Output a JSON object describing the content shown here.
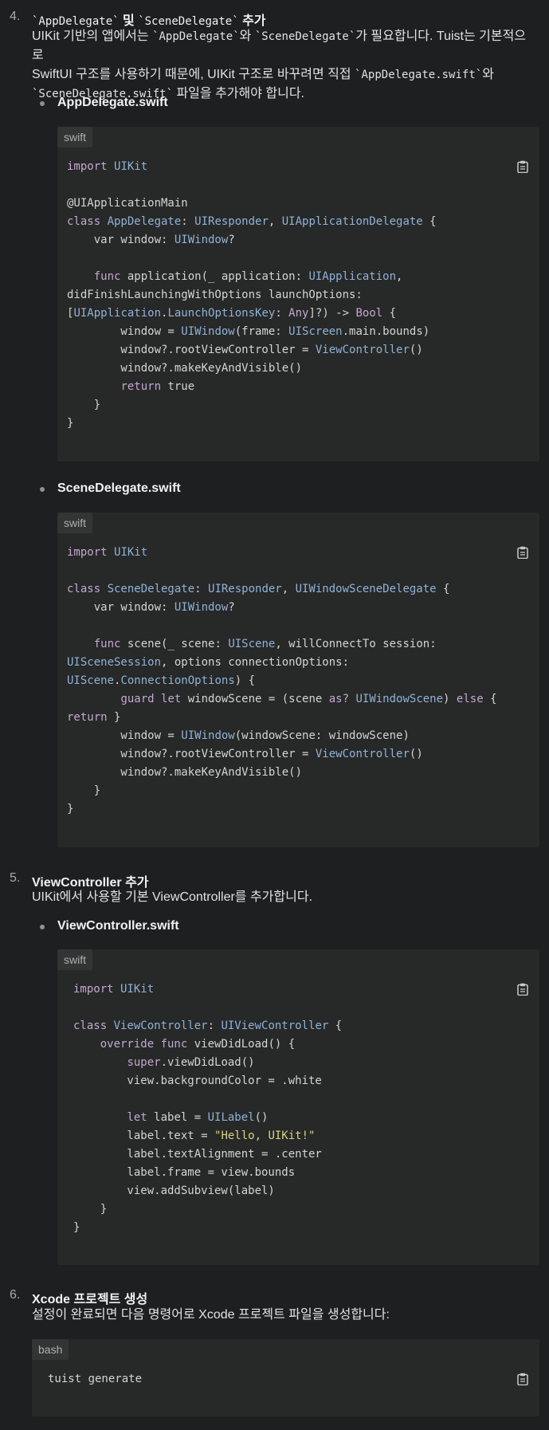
{
  "sections": {
    "s4": {
      "number": "4.",
      "title_parts": [
        "`AppDelegate`",
        " 및 ",
        "`SceneDelegate`",
        " 추가"
      ],
      "desc_line1_parts": [
        "UIKit 기반의 앱에서는 ",
        "`AppDelegate`",
        "와 ",
        "`SceneDelegate`",
        "가 필요합니다. Tuist는 기본적으로"
      ],
      "desc_line2_parts": [
        "SwiftUI 구조를 사용하기 때문에, UIKit 구조로 바꾸려면 직접 ",
        "`AppDelegate.swift`",
        "와"
      ],
      "desc_line3_parts": [
        "`SceneDelegate.swift`",
        " 파일을 추가해야 합니다."
      ],
      "bullets": [
        {
          "label": "AppDelegate.swift",
          "lang": "swift"
        },
        {
          "label": "SceneDelegate.swift",
          "lang": "swift"
        }
      ]
    },
    "s5": {
      "number": "5.",
      "title": "ViewController 추가",
      "desc": "UIKit에서 사용할 기본 ViewController를 추가합니다.",
      "bullets": [
        {
          "label": "ViewController.swift",
          "lang": "swift"
        }
      ]
    },
    "s6": {
      "number": "6.",
      "title": "Xcode 프로젝트 생성",
      "desc": "설정이 완료되면 다음 명령어로 Xcode 프로젝트 파일을 생성합니다:",
      "lang": "bash"
    }
  },
  "code": {
    "appdelegate": [
      [
        [
          "import ",
          "k"
        ],
        [
          "UIKit",
          "t"
        ]
      ],
      [],
      [
        [
          "@UIApplicationMain",
          ""
        ]
      ],
      [
        [
          "class ",
          "k"
        ],
        [
          "AppDelegate",
          "t"
        ],
        [
          ": ",
          ""
        ],
        [
          "UIResponder",
          "t"
        ],
        [
          ", ",
          ""
        ],
        [
          "UIApplicationDelegate",
          "t"
        ],
        [
          " {",
          ""
        ]
      ],
      [
        [
          "    var window: ",
          ""
        ],
        [
          "UIWindow",
          "t"
        ],
        [
          "?",
          ""
        ]
      ],
      [],
      [
        [
          "    ",
          ""
        ],
        [
          "func ",
          "k"
        ],
        [
          "application(_ application: ",
          ""
        ],
        [
          "UIApplication",
          "t"
        ],
        [
          ",",
          ""
        ]
      ],
      [
        [
          "didFinishLaunchingWithOptions launchOptions:",
          ""
        ]
      ],
      [
        [
          "[",
          ""
        ],
        [
          "UIApplication",
          "t"
        ],
        [
          ".",
          ""
        ],
        [
          "LaunchOptionsKey",
          "t"
        ],
        [
          ": ",
          ""
        ],
        [
          "Any",
          "k"
        ],
        [
          "]?) -> ",
          ""
        ],
        [
          "Bool",
          "k"
        ],
        [
          " {",
          ""
        ]
      ],
      [
        [
          "        window = ",
          ""
        ],
        [
          "UIWindow",
          "t"
        ],
        [
          "(frame: ",
          ""
        ],
        [
          "UIScreen",
          "t"
        ],
        [
          ".main.bounds)",
          ""
        ]
      ],
      [
        [
          "        window?.rootViewController = ",
          ""
        ],
        [
          "ViewController",
          "t"
        ],
        [
          "()",
          ""
        ]
      ],
      [
        [
          "        window?.makeKeyAndVisible()",
          ""
        ]
      ],
      [
        [
          "        ",
          ""
        ],
        [
          "return ",
          "k"
        ],
        [
          "true",
          ""
        ]
      ],
      [
        [
          "    }",
          ""
        ]
      ],
      [
        [
          "}",
          ""
        ]
      ]
    ],
    "scenedelegate": [
      [
        [
          "import ",
          "k"
        ],
        [
          "UIKit",
          "t"
        ]
      ],
      [],
      [
        [
          "class ",
          "k"
        ],
        [
          "SceneDelegate",
          "t"
        ],
        [
          ": ",
          ""
        ],
        [
          "UIResponder",
          "t"
        ],
        [
          ", ",
          ""
        ],
        [
          "UIWindowSceneDelegate",
          "t"
        ],
        [
          " {",
          ""
        ]
      ],
      [
        [
          "    var window: ",
          ""
        ],
        [
          "UIWindow",
          "t"
        ],
        [
          "?",
          ""
        ]
      ],
      [],
      [
        [
          "    ",
          ""
        ],
        [
          "func ",
          "k"
        ],
        [
          "scene(_ scene: ",
          ""
        ],
        [
          "UIScene",
          "t"
        ],
        [
          ", willConnectTo session:",
          ""
        ]
      ],
      [
        [
          "UISceneSession",
          "t"
        ],
        [
          ", options connectionOptions:",
          ""
        ]
      ],
      [
        [
          "UIScene",
          "t"
        ],
        [
          ".",
          ""
        ],
        [
          "ConnectionOptions",
          "t"
        ],
        [
          ") {",
          ""
        ]
      ],
      [
        [
          "        ",
          ""
        ],
        [
          "guard let ",
          "k"
        ],
        [
          "windowScene = (scene ",
          ""
        ],
        [
          "as? ",
          "k"
        ],
        [
          "UIWindowScene",
          "t"
        ],
        [
          ") ",
          ""
        ],
        [
          "else ",
          "k"
        ],
        [
          "{",
          ""
        ]
      ],
      [
        [
          "return ",
          "k"
        ],
        [
          "}",
          ""
        ]
      ],
      [
        [
          "        window = ",
          ""
        ],
        [
          "UIWindow",
          "t"
        ],
        [
          "(windowScene: windowScene)",
          ""
        ]
      ],
      [
        [
          "        window?.rootViewController = ",
          ""
        ],
        [
          "ViewController",
          "t"
        ],
        [
          "()",
          ""
        ]
      ],
      [
        [
          "        window?.makeKeyAndVisible()",
          ""
        ]
      ],
      [
        [
          "    }",
          ""
        ]
      ],
      [
        [
          "}",
          ""
        ]
      ]
    ],
    "viewcontroller": [
      [
        [
          "import ",
          "k"
        ],
        [
          "UIKit",
          "t"
        ]
      ],
      [],
      [
        [
          "class ",
          "k"
        ],
        [
          "ViewController",
          "t"
        ],
        [
          ": ",
          ""
        ],
        [
          "UIViewController",
          "t"
        ],
        [
          " {",
          ""
        ]
      ],
      [
        [
          "    ",
          ""
        ],
        [
          "override func ",
          "k"
        ],
        [
          "viewDidLoad() {",
          ""
        ]
      ],
      [
        [
          "        ",
          ""
        ],
        [
          "super",
          "k"
        ],
        [
          ".viewDidLoad()",
          ""
        ]
      ],
      [
        [
          "        view.backgroundColor = .white",
          ""
        ]
      ],
      [],
      [
        [
          "        ",
          ""
        ],
        [
          "let ",
          "k"
        ],
        [
          "label = ",
          ""
        ],
        [
          "UILabel",
          "t"
        ],
        [
          "()",
          ""
        ]
      ],
      [
        [
          "        label.text = ",
          ""
        ],
        [
          "\"Hello, UIKit!\"",
          "s"
        ]
      ],
      [
        [
          "        label.textAlignment = .center",
          ""
        ]
      ],
      [
        [
          "        label.frame = view.bounds",
          ""
        ]
      ],
      [
        [
          "        view.addSubview(label)",
          ""
        ]
      ],
      [
        [
          "    }",
          ""
        ]
      ],
      [
        [
          "}",
          ""
        ]
      ]
    ],
    "bash": [
      [
        [
          "tuist generate",
          ""
        ]
      ]
    ]
  },
  "icons": {
    "copy": "clipboard-icon"
  },
  "colors": {
    "keyword": "#c4a7d3",
    "type": "#8fb3d7",
    "string": "#d7d47f",
    "code_bg": "#272828",
    "page_bg": "#1d1f20"
  }
}
